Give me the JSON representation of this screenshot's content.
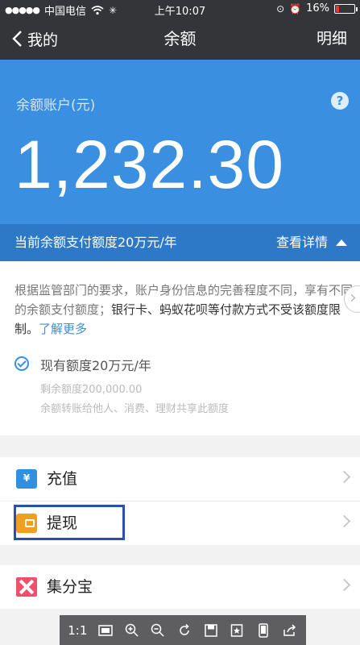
{
  "status_bar": {
    "signal_dots": "●●●●●",
    "carrier": "中国电信",
    "wifi_icon": "wifi-icon",
    "time": "上午10:07",
    "battery": "16%",
    "battery_level": 0.16
  },
  "nav": {
    "back_label": "我的",
    "title": "余额",
    "detail_label": "明细"
  },
  "balance": {
    "label": "余额账户(元)",
    "help": "?",
    "amount": "1,232.30"
  },
  "quota": {
    "text": "当前余额支付额度20万元/年",
    "detail_label": "查看详情"
  },
  "info": {
    "text_part1": "根据监管部门的要求，账户身份信息的完善程度不同，享有不同的余额支付额度；",
    "text_strong": "银行卡、蚂蚁花呗等付款方式不受该额度限制。",
    "link": "了解更多",
    "quota_now": "现有额度20万元/年",
    "quota_left": "剩余额度200,000.00",
    "quota_note": "余额转账给他人、消费、理财共享此额度"
  },
  "menu": {
    "recharge": "充值",
    "withdraw": "提现",
    "jifenbao": "集分宝"
  },
  "toolbar": {
    "ratio": "1:1"
  },
  "colors": {
    "header": "#333538",
    "card_blue": "#3a8fe0",
    "quota_blue": "#2d79c7",
    "highlight": "#2a4fb0"
  }
}
